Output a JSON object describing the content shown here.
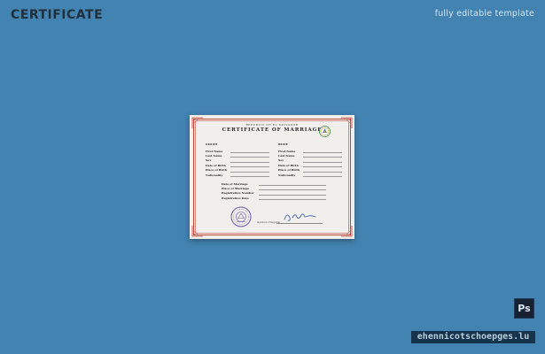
{
  "header": {
    "brand": "CERTIFICATE",
    "tagline": "fully editable template"
  },
  "certificate": {
    "pre_title": "REPUBLIC OF EL SALVADOR",
    "title": "CERTIFICATE OF MARRIAGE",
    "party1_heading": "GROOM",
    "party2_heading": "BRIDE",
    "labels": {
      "first_name": "First Name",
      "last_name": "Last Name",
      "sex": "Sex",
      "dob": "Date of Birth",
      "pob": "Place of Birth",
      "nationality": "Nationality",
      "date_of_marriage": "Date of Marriage",
      "place_of_marriage": "Place of Marriage",
      "registration_number": "Registration Number",
      "registration_date": "Registration Date"
    },
    "signature_caption": "Signature of Registrar"
  },
  "icons": {
    "emblem": "coat-of-arms-icon",
    "seal": "official-seal-icon",
    "signature": "handwritten-signature"
  },
  "badge": {
    "app": "Ps"
  },
  "watermark": "ehennicotschoepges.lu",
  "colors": {
    "background": "#4383b1",
    "frame": "#c0463a",
    "paper": "#f1efec",
    "seal": "#6b5aa8",
    "signature": "#3b63a8"
  }
}
